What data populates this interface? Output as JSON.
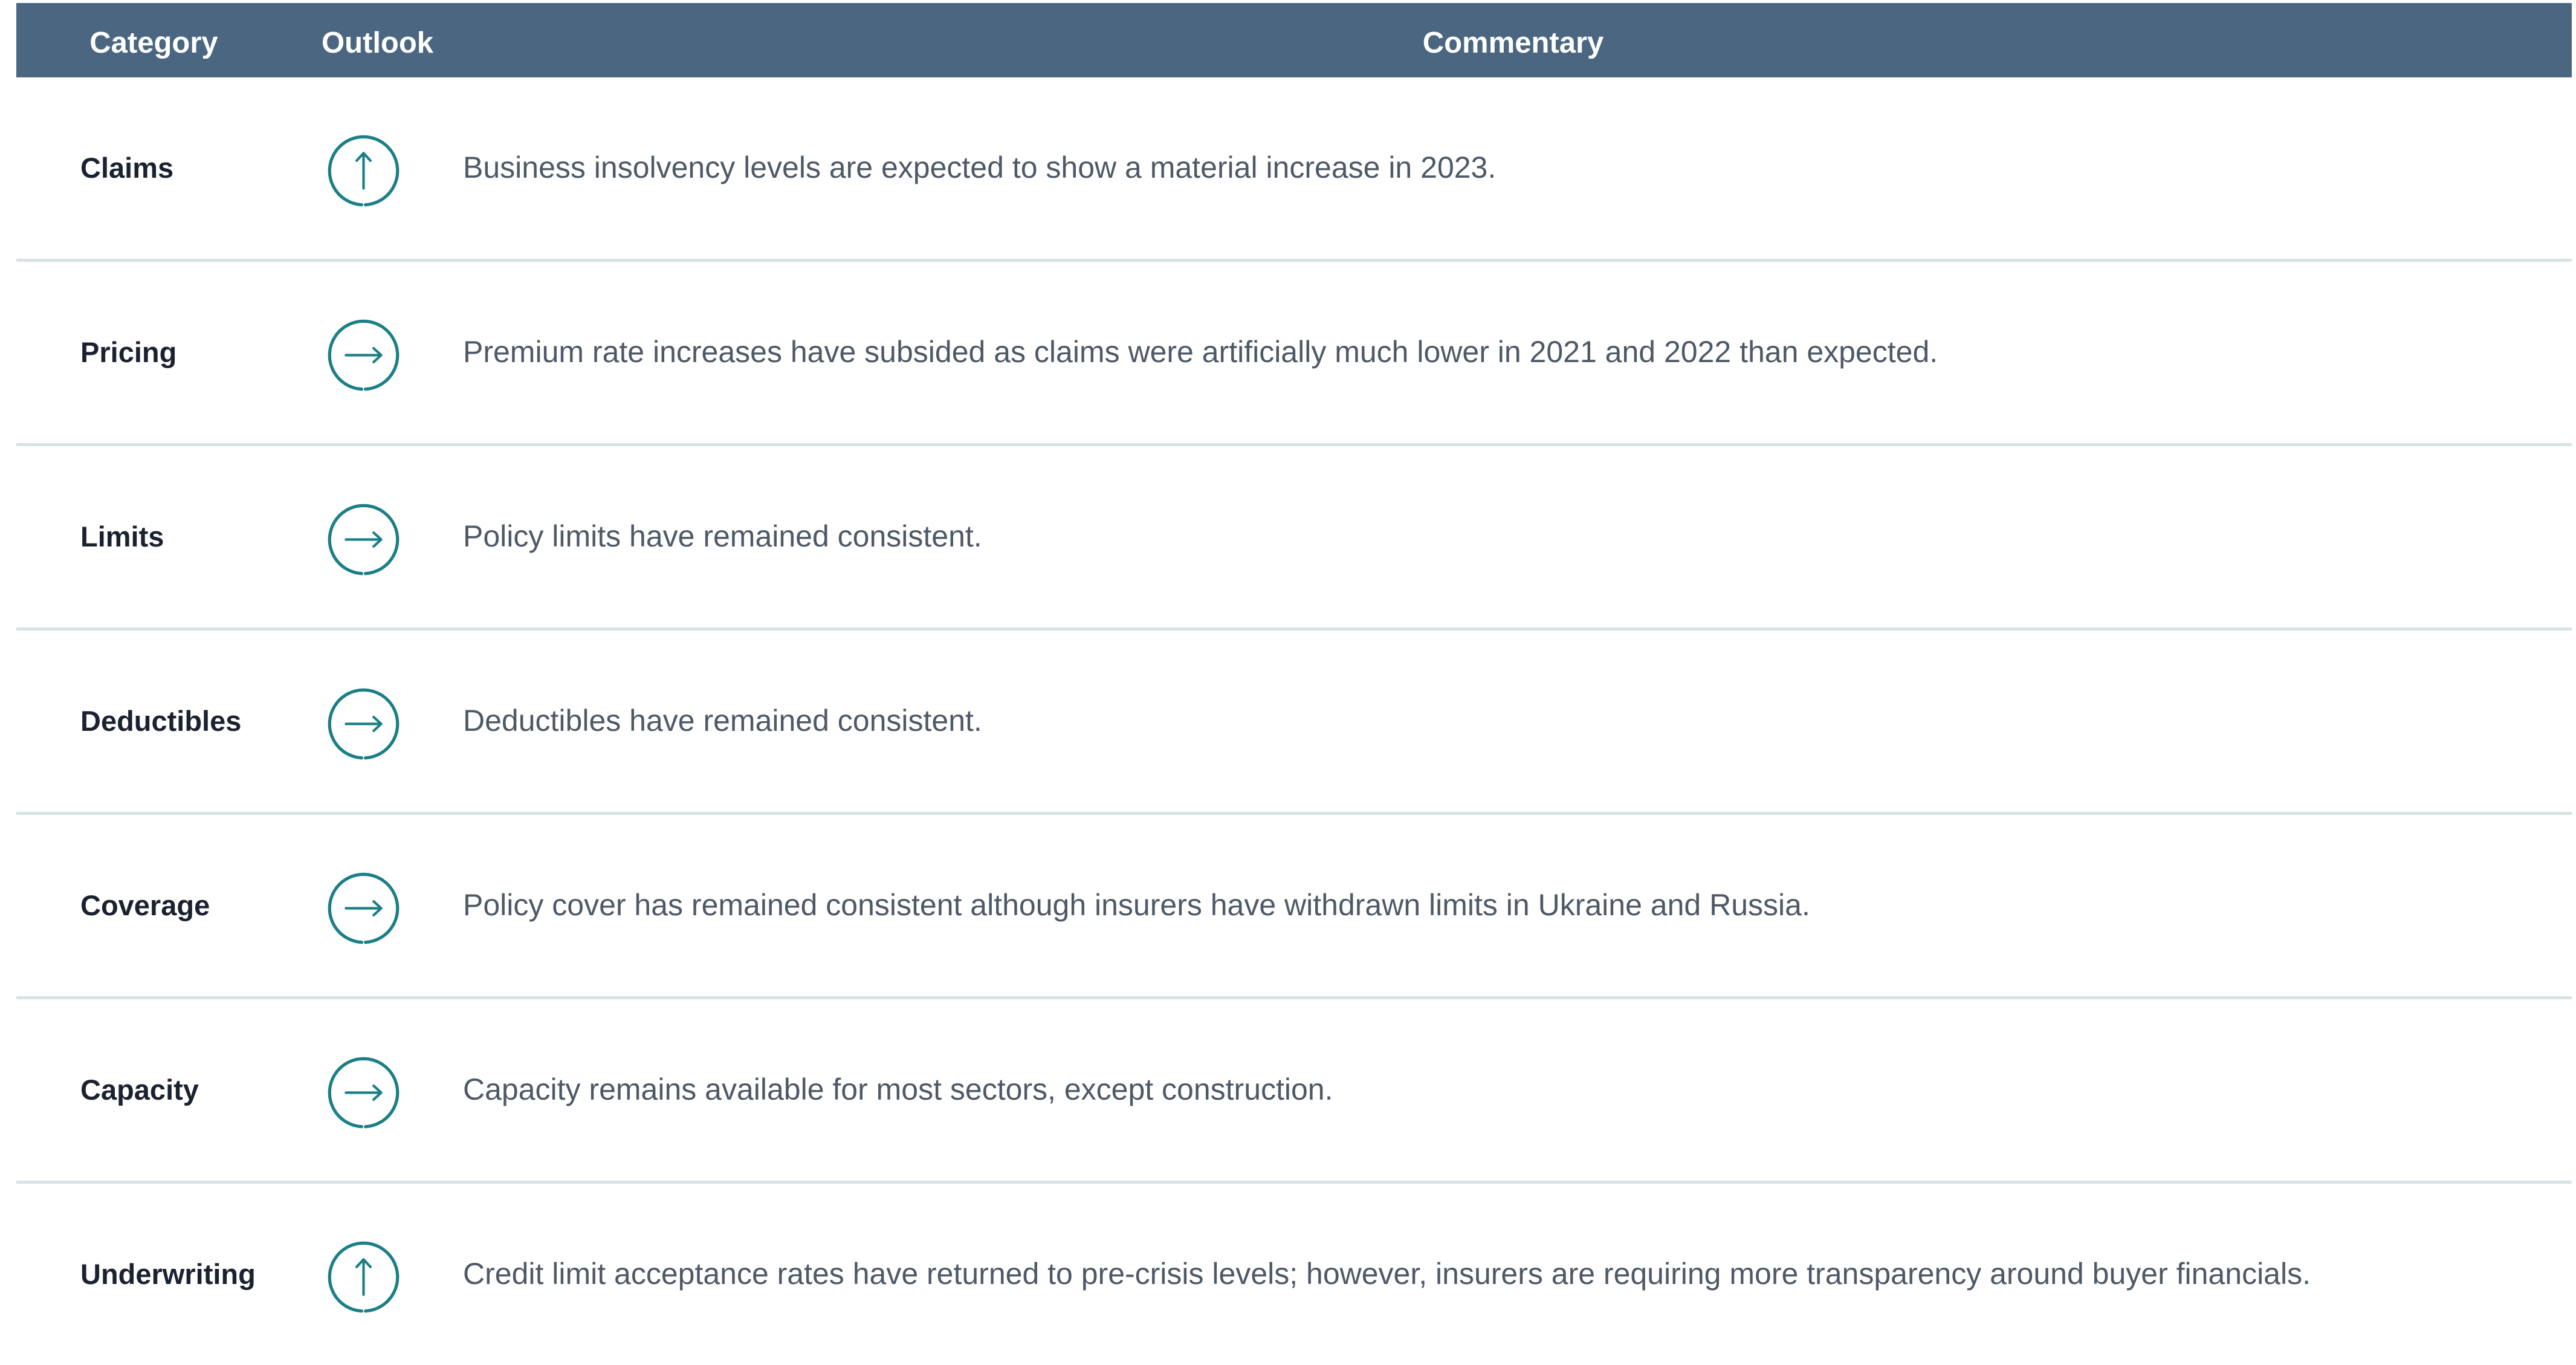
{
  "header": {
    "category": "Category",
    "outlook": "Outlook",
    "commentary": "Commentary"
  },
  "colors": {
    "header_bg": "#4a6680",
    "icon_teal": "#1b7f86",
    "divider": "#d5e3e3"
  },
  "rows": [
    {
      "category": "Claims",
      "outlook": "up",
      "icon": "arrow-up-circle-icon",
      "commentary": "Business insolvency levels are expected to show a material increase in 2023."
    },
    {
      "category": "Pricing",
      "outlook": "flat",
      "icon": "arrow-right-circle-icon",
      "commentary": "Premium rate increases have subsided as claims were artificially much lower in 2021 and 2022 than expected."
    },
    {
      "category": "Limits",
      "outlook": "flat",
      "icon": "arrow-right-circle-icon",
      "commentary": "Policy limits have remained consistent."
    },
    {
      "category": "Deductibles",
      "outlook": "flat",
      "icon": "arrow-right-circle-icon",
      "commentary": "Deductibles have remained consistent."
    },
    {
      "category": "Coverage",
      "outlook": "flat",
      "icon": "arrow-right-circle-icon",
      "commentary": "Policy cover has remained consistent although insurers have withdrawn limits in Ukraine and Russia."
    },
    {
      "category": "Capacity",
      "outlook": "flat",
      "icon": "arrow-right-circle-icon",
      "commentary": "Capacity remains available for most sectors, except construction."
    },
    {
      "category": "Underwriting",
      "outlook": "up",
      "icon": "arrow-up-circle-icon",
      "commentary": "Credit limit acceptance rates have returned to pre-crisis levels; however, insurers are requiring more transparency around buyer financials."
    }
  ]
}
